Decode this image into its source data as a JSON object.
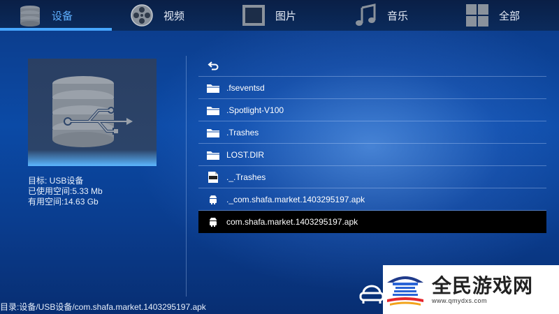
{
  "nav": {
    "tabs": [
      {
        "label": "设备",
        "icon": "database-icon",
        "active": true
      },
      {
        "label": "视频",
        "icon": "film-reel-icon",
        "active": false
      },
      {
        "label": "图片",
        "icon": "picture-frame-icon",
        "active": false
      },
      {
        "label": "音乐",
        "icon": "music-note-icon",
        "active": false
      },
      {
        "label": "全部",
        "icon": "grid-icon",
        "active": false
      }
    ],
    "accent": "#47a7ff"
  },
  "device": {
    "icon": "usb-database-icon",
    "target": "目标: USB设备",
    "used": "已使用空间:5.33 Mb",
    "free": "有用空间:14.63 Gb"
  },
  "files": [
    {
      "name": "",
      "icon": "back-arrow-icon"
    },
    {
      "name": ".fseventsd",
      "icon": "folder-icon"
    },
    {
      "name": ".Spotlight-V100",
      "icon": "folder-icon"
    },
    {
      "name": ".Trashes",
      "icon": "folder-icon"
    },
    {
      "name": "LOST.DIR",
      "icon": "folder-icon"
    },
    {
      "name": "._.Trashes",
      "icon": "text-file-icon"
    },
    {
      "name": "._com.shafa.market.1403295197.apk",
      "icon": "android-icon"
    },
    {
      "name": "com.shafa.market.1403295197.apk",
      "icon": "android-icon",
      "selected": true
    }
  ],
  "status": {
    "path": "目录:设备/USB设备/com.shafa.market.1403295197.apk"
  },
  "watermark": {
    "title": "全民游戏网",
    "url": "www.qmydxs.com"
  }
}
